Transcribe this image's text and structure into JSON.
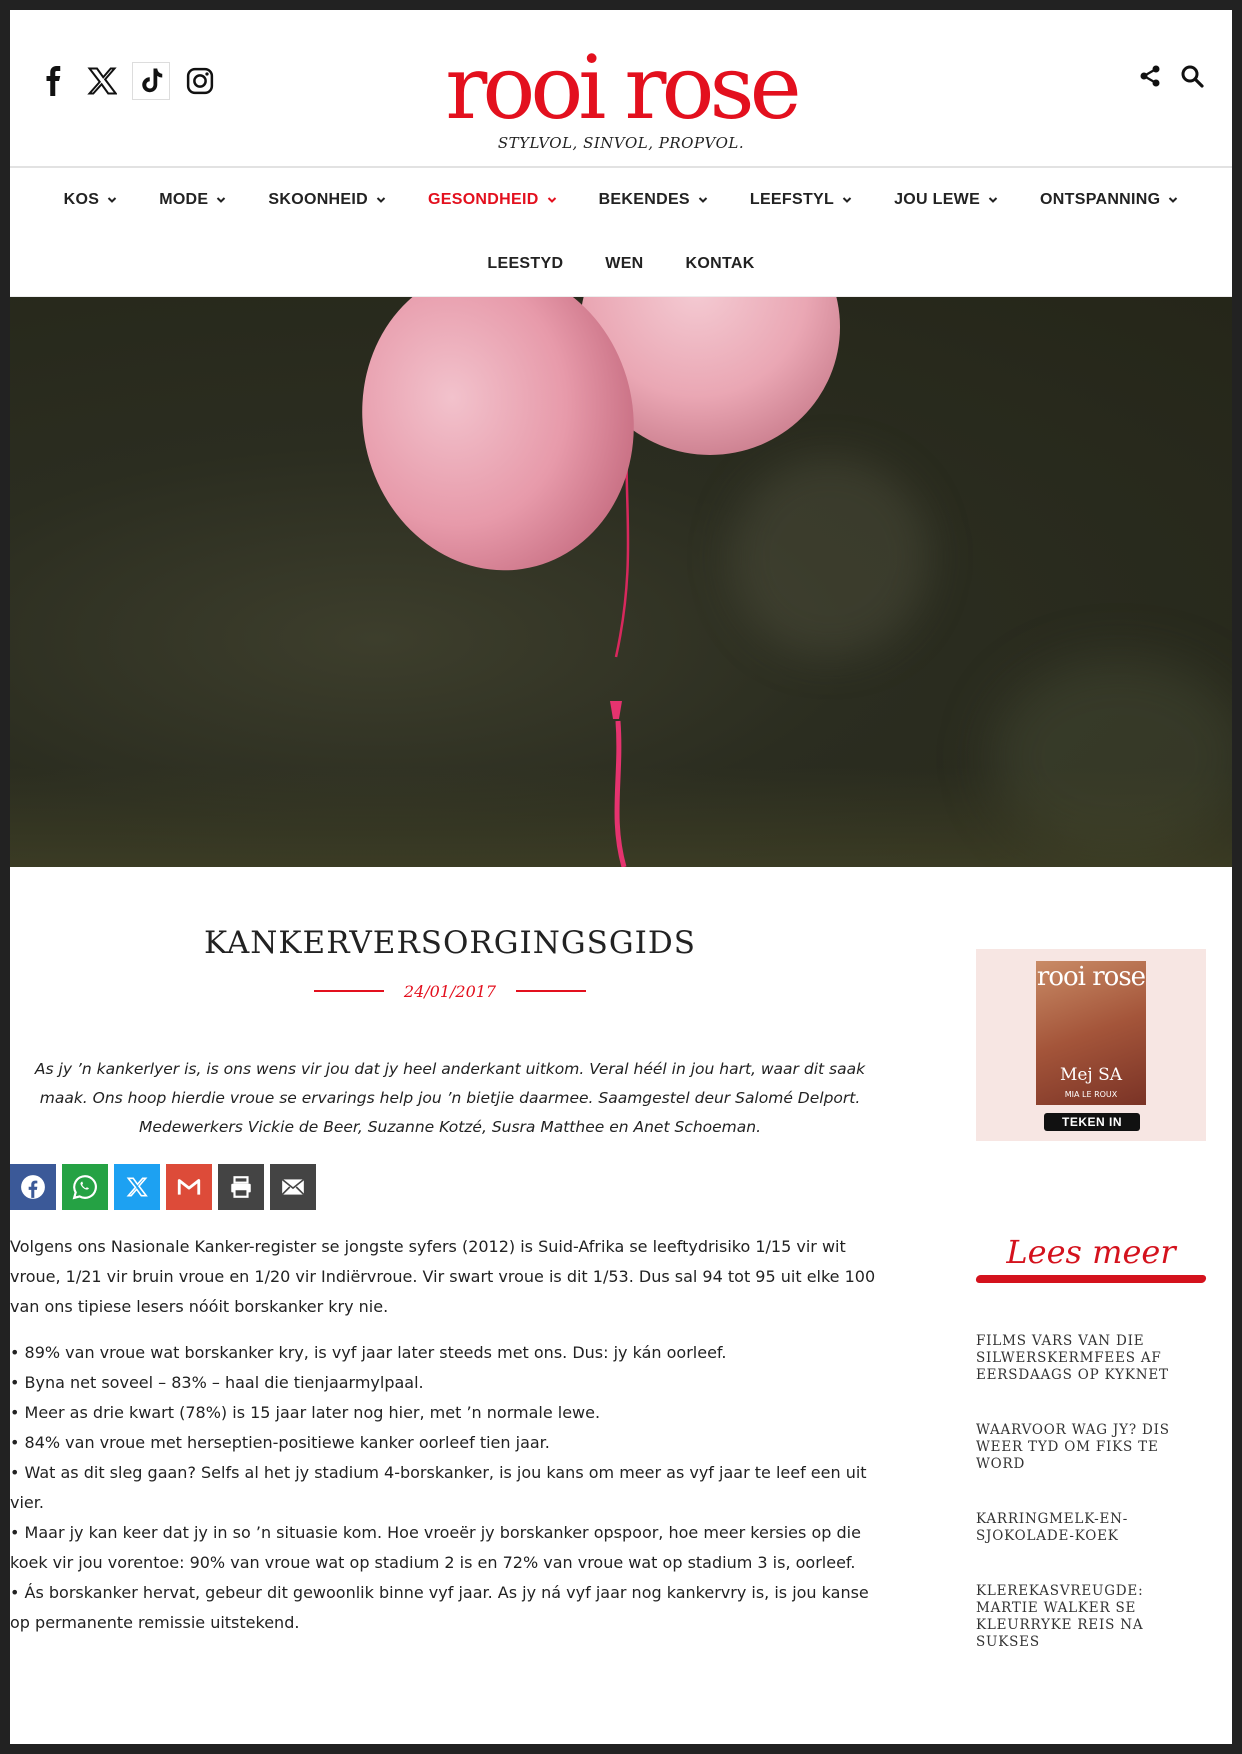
{
  "header": {
    "logo": "rooi rose",
    "tagline": "STYLVOL, SINVOL, PROPVOL.",
    "social_icons": [
      "facebook-icon",
      "x-icon",
      "tiktok-icon",
      "instagram-icon"
    ],
    "tool_icons": [
      "share-icon",
      "search-icon"
    ]
  },
  "nav": {
    "row1": [
      {
        "label": "KOS",
        "dropdown": true
      },
      {
        "label": "MODE",
        "dropdown": true
      },
      {
        "label": "SKOONHEID",
        "dropdown": true
      },
      {
        "label": "GESONDHEID",
        "dropdown": true,
        "active": true
      },
      {
        "label": "BEKENDES",
        "dropdown": true
      },
      {
        "label": "LEEFSTYL",
        "dropdown": true
      },
      {
        "label": "JOU LEWE",
        "dropdown": true
      },
      {
        "label": "ONTSPANNING",
        "dropdown": true
      }
    ],
    "row2": [
      {
        "label": "LEESTYD"
      },
      {
        "label": "WEN"
      },
      {
        "label": "KONTAK"
      }
    ]
  },
  "article": {
    "title": "KANKERVERSORGINGSGIDS",
    "date": "24/01/2017",
    "intro": "As jy ’n kankerlyer is, is ons wens vir jou dat jy heel anderkant uitkom. Veral héél in jou hart, waar dit saak maak. Ons hoop hierdie vroue se ervarings help jou ’n bietjie daarmee. Saamgestel deur Salomé Delport. Medewerkers Vickie de Beer, Suzanne Kotzé, Susra Matthee en Anet Schoeman.",
    "paragraph1": "Volgens ons Nasionale Kanker-register se jongste syfers (2012) is Suid-Afrika se leeftydrisiko 1/15 vir wit vroue, 1/21 vir bruin vroue en 1/20 vir Indiërvroue. Vir swart vroue is dit 1/53. Dus sal 94 tot 95 uit elke 100 van ons tipiese lesers nóóit borskanker kry nie.",
    "bullets": [
      "• 89% van vroue wat borskanker kry, is vyf jaar later steeds met ons. Dus: jy kán oorleef.",
      "• Byna net soveel – 83% – haal die tienjaarmylpaal.",
      "• Meer as drie kwart (78%) is 15 jaar later nog hier, met ’n normale lewe.",
      "• 84% van vroue met herseptien-positiewe kanker oorleef tien jaar.",
      "• Wat as dit sleg gaan? Selfs al het jy stadium 4-borskanker, is jou kans om meer as vyf jaar te leef een uit vier.",
      "• Maar jy kan keer dat jy in so ’n situasie kom. Hoe vroeër jy borskanker opspoor, hoe meer kersies op die koek vir jou vorentoe: 90% van vroue wat op stadium 2 is en 72% van vroue wat op stadium 3 is, oorleef.",
      "• Ás borskanker hervat, gebeur dit gewoonlik binne vyf jaar. As jy ná vyf jaar nog kankervry is, is jou kanse op permanente remissie uitstekend."
    ]
  },
  "share_buttons": [
    {
      "name": "facebook-share-button",
      "icon": "facebook-icon",
      "color": "#3b5998"
    },
    {
      "name": "whatsapp-share-button",
      "icon": "whatsapp-icon",
      "color": "#25a244"
    },
    {
      "name": "x-share-button",
      "icon": "x-icon",
      "color": "#1da1f2"
    },
    {
      "name": "gmail-share-button",
      "icon": "gmail-icon",
      "color": "#dd4b39"
    },
    {
      "name": "print-share-button",
      "icon": "print-icon",
      "color": "#444444"
    },
    {
      "name": "email-share-button",
      "icon": "email-icon",
      "color": "#444444"
    }
  ],
  "sidebar": {
    "ad": {
      "cover_logo": "rooi rose",
      "cover_name": "Mej SA",
      "cover_sub": "MIA LE ROUX",
      "cta": "TEKEN IN"
    },
    "lees_meer": "Lees meer",
    "links": [
      "FILMS VARS VAN DIE SILWERSKERMFEES AF EERSDAAGS OP KYKNET",
      "WAARVOOR WAG JY? DIS WEER TYD OM FIKS TE WORD",
      "KARRINGMELK-EN-SJOKOLADE-KOEK",
      "KLEREKASVREUGDE: MARTIE WALKER SE KLEURRYKE REIS NA SUKSES"
    ]
  },
  "colors": {
    "brand_red": "#e3101e",
    "text": "#222222",
    "sidebar_ad_bg": "#f7e6e3"
  }
}
